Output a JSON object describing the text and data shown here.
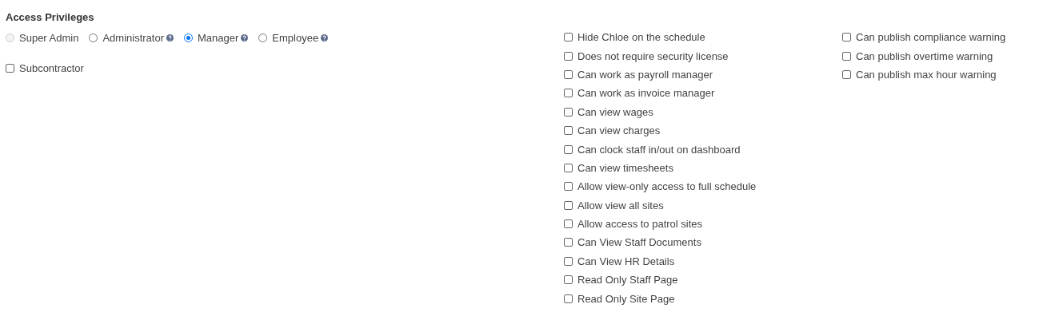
{
  "title": "Access Privileges",
  "roles": [
    {
      "label": "Super Admin",
      "selected": false,
      "disabled": true,
      "help": false
    },
    {
      "label": "Administrator",
      "selected": false,
      "disabled": false,
      "help": true
    },
    {
      "label": "Manager",
      "selected": true,
      "disabled": false,
      "help": true
    },
    {
      "label": "Employee",
      "selected": false,
      "disabled": false,
      "help": true
    }
  ],
  "subcontractor": {
    "label": "Subcontractor",
    "checked": false
  },
  "permissions": [
    {
      "label": "Hide Chloe on the schedule",
      "checked": false
    },
    {
      "label": "Does not require security license",
      "checked": false
    },
    {
      "label": "Can work as payroll manager",
      "checked": false
    },
    {
      "label": "Can work as invoice manager",
      "checked": false
    },
    {
      "label": "Can view wages",
      "checked": false
    },
    {
      "label": "Can view charges",
      "checked": false
    },
    {
      "label": "Can clock staff in/out on dashboard",
      "checked": false
    },
    {
      "label": "Can view timesheets",
      "checked": false
    },
    {
      "label": "Allow view-only access to full schedule",
      "checked": false
    },
    {
      "label": "Allow view all sites",
      "checked": false
    },
    {
      "label": "Allow access to patrol sites",
      "checked": false
    },
    {
      "label": "Can View Staff Documents",
      "checked": false
    },
    {
      "label": "Can View HR Details",
      "checked": false
    },
    {
      "label": "Read Only Staff Page",
      "checked": false
    },
    {
      "label": "Read Only Site Page",
      "checked": false
    }
  ],
  "warnings": [
    {
      "label": "Can publish compliance warning",
      "checked": false
    },
    {
      "label": "Can publish overtime warning",
      "checked": false
    },
    {
      "label": "Can publish max hour warning",
      "checked": false
    }
  ]
}
